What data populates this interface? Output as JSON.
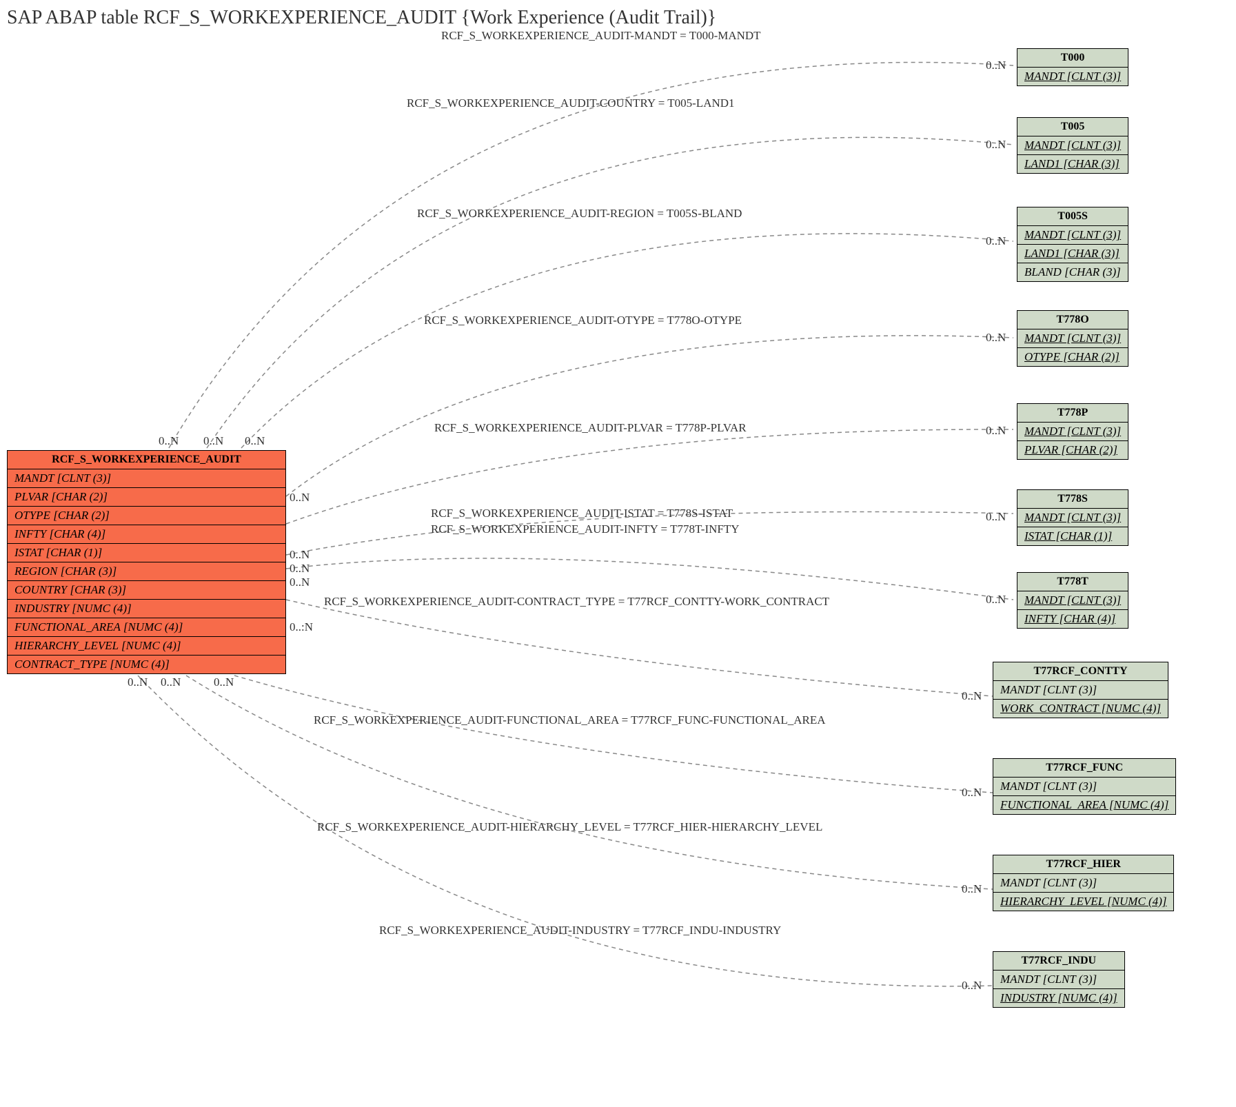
{
  "title": "SAP ABAP table RCF_S_WORKEXPERIENCE_AUDIT {Work Experience (Audit Trail)}",
  "main": {
    "name": "RCF_S_WORKEXPERIENCE_AUDIT",
    "fields": [
      "MANDT [CLNT (3)]",
      "PLVAR [CHAR (2)]",
      "OTYPE [CHAR (2)]",
      "INFTY [CHAR (4)]",
      "ISTAT [CHAR (1)]",
      "REGION [CHAR (3)]",
      "COUNTRY [CHAR (3)]",
      "INDUSTRY [NUMC (4)]",
      "FUNCTIONAL_AREA [NUMC (4)]",
      "HIERARCHY_LEVEL [NUMC (4)]",
      "CONTRACT_TYPE [NUMC (4)]"
    ]
  },
  "targets": [
    {
      "name": "T000",
      "fields": [
        "MANDT [CLNT (3)]"
      ],
      "underline": [
        true
      ]
    },
    {
      "name": "T005",
      "fields": [
        "MANDT [CLNT (3)]",
        "LAND1 [CHAR (3)]"
      ],
      "underline": [
        true,
        true
      ]
    },
    {
      "name": "T005S",
      "fields": [
        "MANDT [CLNT (3)]",
        "LAND1 [CHAR (3)]",
        "BLAND [CHAR (3)]"
      ],
      "underline": [
        true,
        true,
        false
      ]
    },
    {
      "name": "T778O",
      "fields": [
        "MANDT [CLNT (3)]",
        "OTYPE [CHAR (2)]"
      ],
      "underline": [
        true,
        true
      ]
    },
    {
      "name": "T778P",
      "fields": [
        "MANDT [CLNT (3)]",
        "PLVAR [CHAR (2)]"
      ],
      "underline": [
        true,
        true
      ]
    },
    {
      "name": "T778S",
      "fields": [
        "MANDT [CLNT (3)]",
        "ISTAT [CHAR (1)]"
      ],
      "underline": [
        true,
        true
      ]
    },
    {
      "name": "T778T",
      "fields": [
        "MANDT [CLNT (3)]",
        "INFTY [CHAR (4)]"
      ],
      "underline": [
        true,
        true
      ]
    },
    {
      "name": "T77RCF_CONTTY",
      "fields": [
        "MANDT [CLNT (3)]",
        "WORK_CONTRACT [NUMC (4)]"
      ],
      "underline": [
        false,
        true
      ]
    },
    {
      "name": "T77RCF_FUNC",
      "fields": [
        "MANDT [CLNT (3)]",
        "FUNCTIONAL_AREA [NUMC (4)]"
      ],
      "underline": [
        false,
        true
      ]
    },
    {
      "name": "T77RCF_HIER",
      "fields": [
        "MANDT [CLNT (3)]",
        "HIERARCHY_LEVEL [NUMC (4)]"
      ],
      "underline": [
        false,
        true
      ]
    },
    {
      "name": "T77RCF_INDU",
      "fields": [
        "MANDT [CLNT (3)]",
        "INDUSTRY [NUMC (4)]"
      ],
      "underline": [
        false,
        true
      ]
    }
  ],
  "relations": [
    "RCF_S_WORKEXPERIENCE_AUDIT-MANDT = T000-MANDT",
    "RCF_S_WORKEXPERIENCE_AUDIT-COUNTRY = T005-LAND1",
    "RCF_S_WORKEXPERIENCE_AUDIT-REGION = T005S-BLAND",
    "RCF_S_WORKEXPERIENCE_AUDIT-OTYPE = T778O-OTYPE",
    "RCF_S_WORKEXPERIENCE_AUDIT-PLVAR = T778P-PLVAR",
    "RCF_S_WORKEXPERIENCE_AUDIT-ISTAT = T778S-ISTAT",
    "RCF_S_WORKEXPERIENCE_AUDIT-INFTY = T778T-INFTY",
    "RCF_S_WORKEXPERIENCE_AUDIT-CONTRACT_TYPE = T77RCF_CONTTY-WORK_CONTRACT",
    "RCF_S_WORKEXPERIENCE_AUDIT-FUNCTIONAL_AREA = T77RCF_FUNC-FUNCTIONAL_AREA",
    "RCF_S_WORKEXPERIENCE_AUDIT-HIERARCHY_LEVEL = T77RCF_HIER-HIERARCHY_LEVEL",
    "RCF_S_WORKEXPERIENCE_AUDIT-INDUSTRY = T77RCF_INDU-INDUSTRY"
  ],
  "card_main_top": [
    "0..N",
    "0..N",
    "0..N"
  ],
  "card_main_right": [
    "0..N",
    "0..N",
    "0..N",
    "0..N",
    "0..:N"
  ],
  "card_main_bottom": [
    "0..N",
    "0..N",
    "0..N"
  ],
  "card_target": [
    "0..N",
    "0..N",
    "0..N",
    "0..N",
    "0..N",
    "0..N",
    "0..N",
    "0..N",
    "0..N",
    "0..N",
    "0..N"
  ],
  "chart_data": {
    "type": "table",
    "description": "Entity-relationship diagram for SAP ABAP table RCF_S_WORKEXPERIENCE_AUDIT",
    "main_entity": {
      "name": "RCF_S_WORKEXPERIENCE_AUDIT",
      "fields": [
        "MANDT [CLNT (3)]",
        "PLVAR [CHAR (2)]",
        "OTYPE [CHAR (2)]",
        "INFTY [CHAR (4)]",
        "ISTAT [CHAR (1)]",
        "REGION [CHAR (3)]",
        "COUNTRY [CHAR (3)]",
        "INDUSTRY [NUMC (4)]",
        "FUNCTIONAL_AREA [NUMC (4)]",
        "HIERARCHY_LEVEL [NUMC (4)]",
        "CONTRACT_TYPE [NUMC (4)]"
      ]
    },
    "related_entities": [
      {
        "name": "T000",
        "fields": [
          "MANDT [CLNT (3)]"
        ]
      },
      {
        "name": "T005",
        "fields": [
          "MANDT [CLNT (3)]",
          "LAND1 [CHAR (3)]"
        ]
      },
      {
        "name": "T005S",
        "fields": [
          "MANDT [CLNT (3)]",
          "LAND1 [CHAR (3)]",
          "BLAND [CHAR (3)]"
        ]
      },
      {
        "name": "T778O",
        "fields": [
          "MANDT [CLNT (3)]",
          "OTYPE [CHAR (2)]"
        ]
      },
      {
        "name": "T778P",
        "fields": [
          "MANDT [CLNT (3)]",
          "PLVAR [CHAR (2)]"
        ]
      },
      {
        "name": "T778S",
        "fields": [
          "MANDT [CLNT (3)]",
          "ISTAT [CHAR (1)]"
        ]
      },
      {
        "name": "T778T",
        "fields": [
          "MANDT [CLNT (3)]",
          "INFTY [CHAR (4)]"
        ]
      },
      {
        "name": "T77RCF_CONTTY",
        "fields": [
          "MANDT [CLNT (3)]",
          "WORK_CONTRACT [NUMC (4)]"
        ]
      },
      {
        "name": "T77RCF_FUNC",
        "fields": [
          "MANDT [CLNT (3)]",
          "FUNCTIONAL_AREA [NUMC (4)]"
        ]
      },
      {
        "name": "T77RCF_HIER",
        "fields": [
          "MANDT [CLNT (3)]",
          "HIERARCHY_LEVEL [NUMC (4)]"
        ]
      },
      {
        "name": "T77RCF_INDU",
        "fields": [
          "MANDT [CLNT (3)]",
          "INDUSTRY [NUMC (4)]"
        ]
      }
    ],
    "relationships": [
      {
        "from": "RCF_S_WORKEXPERIENCE_AUDIT.MANDT",
        "to": "T000.MANDT",
        "cardinality": "0..N - 0..N"
      },
      {
        "from": "RCF_S_WORKEXPERIENCE_AUDIT.COUNTRY",
        "to": "T005.LAND1",
        "cardinality": "0..N - 0..N"
      },
      {
        "from": "RCF_S_WORKEXPERIENCE_AUDIT.REGION",
        "to": "T005S.BLAND",
        "cardinality": "0..N - 0..N"
      },
      {
        "from": "RCF_S_WORKEXPERIENCE_AUDIT.OTYPE",
        "to": "T778O.OTYPE",
        "cardinality": "0..N - 0..N"
      },
      {
        "from": "RCF_S_WORKEXPERIENCE_AUDIT.PLVAR",
        "to": "T778P.PLVAR",
        "cardinality": "0..N - 0..N"
      },
      {
        "from": "RCF_S_WORKEXPERIENCE_AUDIT.ISTAT",
        "to": "T778S.ISTAT",
        "cardinality": "0..N - 0..N"
      },
      {
        "from": "RCF_S_WORKEXPERIENCE_AUDIT.INFTY",
        "to": "T778T.INFTY",
        "cardinality": "0..N - 0..N"
      },
      {
        "from": "RCF_S_WORKEXPERIENCE_AUDIT.CONTRACT_TYPE",
        "to": "T77RCF_CONTTY.WORK_CONTRACT",
        "cardinality": "0..:N - 0..N"
      },
      {
        "from": "RCF_S_WORKEXPERIENCE_AUDIT.FUNCTIONAL_AREA",
        "to": "T77RCF_FUNC.FUNCTIONAL_AREA",
        "cardinality": "0..N - 0..N"
      },
      {
        "from": "RCF_S_WORKEXPERIENCE_AUDIT.HIERARCHY_LEVEL",
        "to": "T77RCF_HIER.HIERARCHY_LEVEL",
        "cardinality": "0..N - 0..N"
      },
      {
        "from": "RCF_S_WORKEXPERIENCE_AUDIT.INDUSTRY",
        "to": "T77RCF_INDU.INDUSTRY",
        "cardinality": "0..N - 0..N"
      }
    ]
  }
}
